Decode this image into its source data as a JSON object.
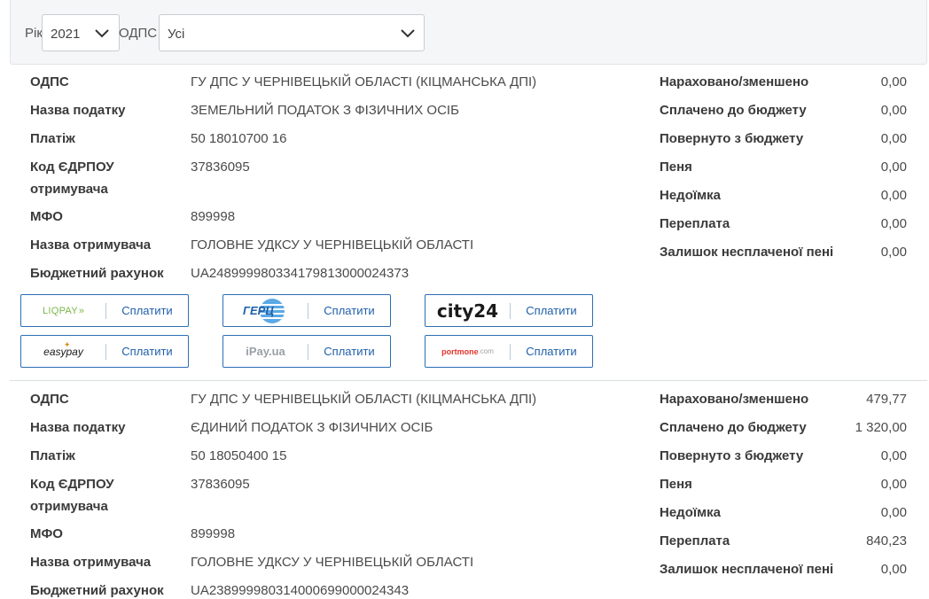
{
  "filters": {
    "year_label": "Рік",
    "year_value": "2021",
    "odps_label": "ОДПС",
    "odps_value": "Усі"
  },
  "labels": {
    "odps": "ОДПС",
    "tax_name": "Назва податку",
    "payment": "Платіж",
    "edrpou_line1": "Код ЄДРПОУ",
    "edrpou_line2": "отримувача",
    "mfo": "МФО",
    "recipient": "Назва отримувача",
    "budget_account": "Бюджетний рахунок",
    "accrued": "Нараховано/зменшено",
    "paid": "Сплачено до бюджету",
    "returned": "Повернуто з бюджету",
    "penalty": "Пеня",
    "arrears": "Недоїмка",
    "overpayment": "Переплата",
    "unpaid_penalty": "Залишок несплаченої пені"
  },
  "records": [
    {
      "odps": "ГУ ДПС У ЧЕРНІВЕЦЬКІЙ ОБЛАСТІ (КІЦМАНСЬКА ДПІ)",
      "tax_name": "ЗЕМЕЛЬНИЙ ПОДАТОК З ФІЗИЧНИХ ОСІБ",
      "payment": "50 18010700 16",
      "edrpou": "37836095",
      "mfo": "899998",
      "recipient": "ГОЛОВНЕ УДКСУ У ЧЕРНІВЕЦЬКІЙ ОБЛАСТІ",
      "budget_account": "UA248999980334179813000024373",
      "accrued": "0,00",
      "paid": "0,00",
      "returned": "0,00",
      "penalty": "0,00",
      "arrears": "0,00",
      "overpayment": "0,00",
      "unpaid_penalty": "0,00"
    },
    {
      "odps": "ГУ ДПС У ЧЕРНІВЕЦЬКІЙ ОБЛАСТІ (КІЦМАНСЬКА ДПІ)",
      "tax_name": "ЄДИНИЙ ПОДАТОК З ФІЗИЧНИХ ОСІБ",
      "payment": "50 18050400 15",
      "edrpou": "37836095",
      "mfo": "899998",
      "recipient": "ГОЛОВНЕ УДКСУ У ЧЕРНІВЕЦЬКІЙ ОБЛАСТІ",
      "budget_account": "UA238999980314000699000024343",
      "accrued": "479,77",
      "paid": "1 320,00",
      "returned": "0,00",
      "penalty": "0,00",
      "arrears": "0,00",
      "overpayment": "840,23",
      "unpaid_penalty": "0,00"
    }
  ],
  "payment_buttons": {
    "pay_label": "Сплатити",
    "providers": [
      {
        "logo_text": "LIQPAY",
        "icon": "liqpay-logo",
        "color": "#7ab648"
      },
      {
        "logo_text": "ГЕРЦ",
        "icon": "gerc-logo",
        "color": "#1f7ac7"
      },
      {
        "logo_text": "city24",
        "icon": "city24-logo",
        "color": "#1a1a1a"
      },
      {
        "logo_text": "easypay",
        "icon": "easypay-logo",
        "color": "#1a1a1a"
      },
      {
        "logo_text": "iPay.ua",
        "icon": "ipay-logo",
        "color": "#9aa0a6"
      },
      {
        "logo_text": "portmone",
        "logo_text_suffix": ".com",
        "icon": "portmone-logo",
        "color": "#e2342b"
      }
    ]
  }
}
